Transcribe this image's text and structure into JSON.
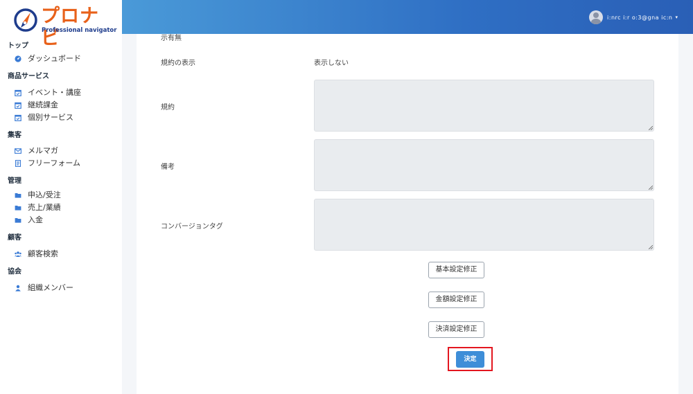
{
  "brand": {
    "name": "プロナビ",
    "tagline": "Professional navigator",
    "accent": "#e8611a",
    "navy": "#1e3c8c"
  },
  "header": {
    "user_name": "i:nrc i:r  o:3@gna  ic:n",
    "caret": "▾"
  },
  "sidebar": {
    "sections": [
      {
        "title": "トップ",
        "items": [
          {
            "label": "ダッシュボード",
            "icon": "dashboard-icon"
          }
        ]
      },
      {
        "title": "商品サービス",
        "items": [
          {
            "label": "イベント・講座",
            "icon": "calendar-check-icon"
          },
          {
            "label": "継続課金",
            "icon": "calendar-check-icon"
          },
          {
            "label": "個別サービス",
            "icon": "calendar-check-icon"
          }
        ]
      },
      {
        "title": "集客",
        "items": [
          {
            "label": "メルマガ",
            "icon": "envelope-icon"
          },
          {
            "label": "フリーフォーム",
            "icon": "form-icon"
          }
        ]
      },
      {
        "title": "管理",
        "items": [
          {
            "label": "申込/受注",
            "icon": "folder-icon"
          },
          {
            "label": "売上/業績",
            "icon": "folder-icon"
          },
          {
            "label": "入金",
            "icon": "folder-icon"
          }
        ]
      },
      {
        "title": "顧客",
        "items": [
          {
            "label": "顧客検索",
            "icon": "users-icon"
          }
        ]
      },
      {
        "title": "協会",
        "items": [
          {
            "label": "組織メンバー",
            "icon": "user-icon"
          }
        ]
      }
    ]
  },
  "form": {
    "partial_label": "示有無",
    "terms_display_label": "規約の表示",
    "terms_display_value": "表示しない",
    "terms_label": "規約",
    "terms_value": "",
    "notes_label": "備考",
    "notes_value": "",
    "conversion_label": "コンバージョンタグ",
    "conversion_value": ""
  },
  "actions": {
    "basic_settings": "基本設定修正",
    "amount_settings": "金額設定修正",
    "payment_settings": "決済設定修正",
    "submit": "決定"
  }
}
